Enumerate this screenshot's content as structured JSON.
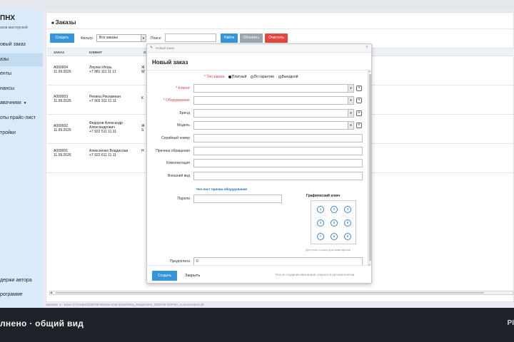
{
  "brand": {
    "name": "ПНХ",
    "subtitle": "азов мастерской"
  },
  "sidebar": {
    "items": [
      {
        "label": "овый заказ"
      },
      {
        "label": "азы"
      },
      {
        "label": "енты"
      },
      {
        "label": "нансы"
      },
      {
        "label": "авочники"
      },
      {
        "label": "оты прайс-лист"
      },
      {
        "label": "тройки"
      },
      {
        "label": "держи автора"
      },
      {
        "label": "рограмме"
      }
    ]
  },
  "page": {
    "title": "Заказы"
  },
  "toolbar": {
    "create_label": "Создать",
    "filter_label": "Фильтр:",
    "filter_value": "Все заказы",
    "search_label": "Поиск:",
    "search_value": "",
    "find_label": "Найти",
    "refresh_label": "Обновить",
    "clear_label": "Очистить"
  },
  "table": {
    "columns": [
      "ЗАКАЗ",
      "КЛИЕНТ",
      "О"
    ],
    "rows": [
      {
        "id": "A000004",
        "date": "11.09.2026",
        "client_name": "Ляулин Игорь",
        "client_phone": "+7 981 111 11 11",
        "device": "Ж",
        "device2": "W"
      },
      {
        "id": "A000003",
        "date": "11.09.2026",
        "client_name": "Репина Рекламная",
        "client_phone": "+7 903 311 11 11",
        "device": "К",
        "device2": ""
      },
      {
        "id": "A000002",
        "date": "11.09.2026",
        "client_name": "Федоров Александр",
        "client_name2": "Александрович",
        "client_phone": "+7 922 511 11 11",
        "device": "Ж",
        "device2": "S"
      },
      {
        "id": "A000001",
        "date": "11.09.2026",
        "client_name": "Алексеенко Владислав",
        "client_phone": "+7 922 611 11 11",
        "device": "Н",
        "device2": ""
      }
    ]
  },
  "status_bar": {
    "text": "Заказов: 4 · База: E:\\Codex\\2026-06-05\\new-chat-2\\work\\test_assignment_2026-06-05\\PNH_source\\orders.db"
  },
  "modal": {
    "bar_title": "Новый заказ",
    "title": "Новый заказ",
    "order_type": {
      "label": "* Тип заказа",
      "options": [
        {
          "label": "Платный",
          "checked": true
        },
        {
          "label": "По гарантии",
          "checked": false
        },
        {
          "label": "Выездной",
          "checked": false
        }
      ]
    },
    "fields": {
      "client": "* Клиент",
      "equipment": "* Оборудование",
      "brand": "Бренд",
      "model": "Модель",
      "serial": "Серийный номер",
      "reason": "Причина обращения",
      "kit": "Комплектация",
      "appearance": "Внешний вид",
      "passwords": "Пароли",
      "prepay": "Предоплата"
    },
    "prepay_value": "0",
    "checklist_link": "Чек-лист приема оборудования",
    "graphic_key": {
      "title": "Графический ключ",
      "dots": [
        "1",
        "2",
        "3",
        "4",
        "5",
        "6",
        "7",
        "8",
        "9"
      ],
      "note": "Доступно только для смартфонов"
    },
    "create_label": "Создать",
    "close_label": "Закрыть",
    "footer_note": "После создания квитанция откроется автоматически"
  },
  "bottom": {
    "title": "лнено · общий вид",
    "right": "РІ"
  },
  "colors": {
    "accent": "#3794d8",
    "danger": "#e3463d",
    "sidebar": "#d9ebf8",
    "dark_bar": "#1d2329"
  }
}
